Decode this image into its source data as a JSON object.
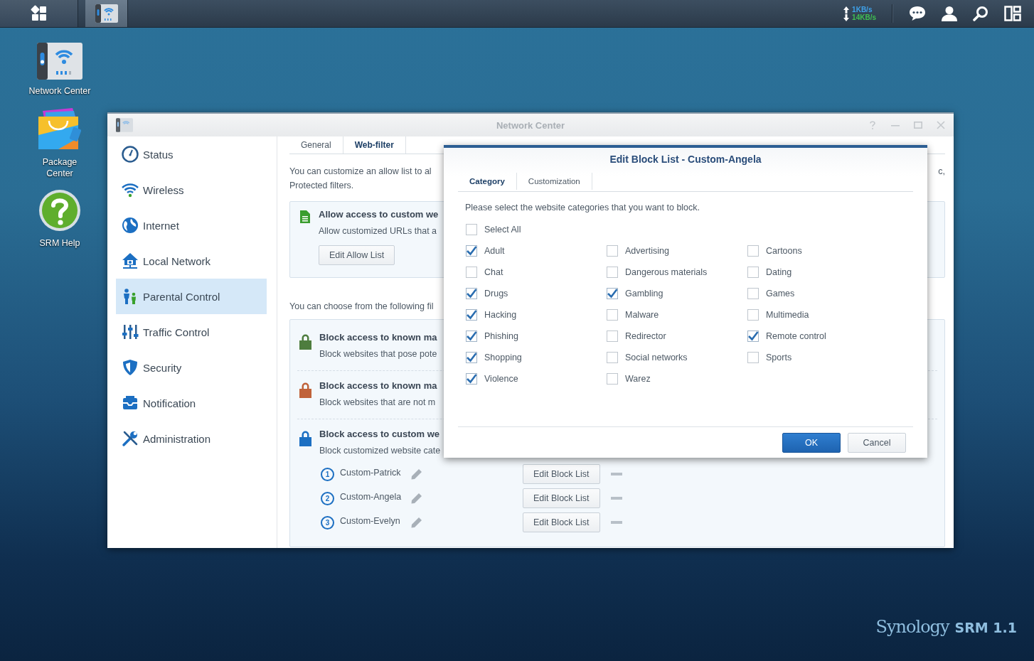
{
  "taskbar": {
    "upload": "1KB/s",
    "download": "14KB/s"
  },
  "desktop_icons": [
    {
      "label": "Network Center",
      "kind": "network"
    },
    {
      "label": "Package Center",
      "kind": "package"
    },
    {
      "label": "SRM Help",
      "kind": "help"
    }
  ],
  "window": {
    "title": "Network Center"
  },
  "sidebar": {
    "items": [
      {
        "label": "Status",
        "kind": "status",
        "selected": false
      },
      {
        "label": "Wireless",
        "kind": "wireless",
        "selected": false
      },
      {
        "label": "Internet",
        "kind": "internet",
        "selected": false
      },
      {
        "label": "Local Network",
        "kind": "local",
        "selected": false
      },
      {
        "label": "Parental Control",
        "kind": "parental",
        "selected": true
      },
      {
        "label": "Traffic Control",
        "kind": "traffic",
        "selected": false
      },
      {
        "label": "Security",
        "kind": "security",
        "selected": false
      },
      {
        "label": "Notification",
        "kind": "notification",
        "selected": false
      },
      {
        "label": "Administration",
        "kind": "administration",
        "selected": false
      }
    ]
  },
  "tabs": [
    {
      "label": "General",
      "selected": false
    },
    {
      "label": "Web-filter",
      "selected": true
    }
  ],
  "intro": {
    "lines": [
      "You can customize an allow list to al",
      "Protected filters."
    ],
    "tail": "c,"
  },
  "allow_section": {
    "title": "Allow access to custom we",
    "description": "Allow customized URLs that a",
    "button": "Edit Allow List"
  },
  "filters_intro": "You can choose from the following fil",
  "filters": [
    {
      "title": "Block access to known ma",
      "description": "Block websites that pose pote",
      "color": "#4e7d3e"
    },
    {
      "title": "Block access to known ma",
      "description": "Block websites that are not m",
      "color": "#c0623a"
    },
    {
      "title": "Block access to custom we",
      "description": "Block customized website cate",
      "color": "#1c6fc2",
      "profiles": [
        {
          "number": "1",
          "name": "Custom-Patrick",
          "button": "Edit Block List"
        },
        {
          "number": "2",
          "name": "Custom-Angela",
          "button": "Edit Block List"
        },
        {
          "number": "3",
          "name": "Custom-Evelyn",
          "button": "Edit Block List"
        }
      ]
    }
  ],
  "dialog": {
    "title": "Edit Block List - Custom-Angela",
    "tabs": [
      {
        "label": "Category",
        "selected": true
      },
      {
        "label": "Customization",
        "selected": false
      }
    ],
    "instruction": "Please select the website categories that you want to block.",
    "select_all": {
      "label": "Select All",
      "checked": false
    },
    "categories": [
      {
        "label": "Adult",
        "checked": true
      },
      {
        "label": "Advertising",
        "checked": false
      },
      {
        "label": "Cartoons",
        "checked": false
      },
      {
        "label": "Chat",
        "checked": false
      },
      {
        "label": "Dangerous materials",
        "checked": false
      },
      {
        "label": "Dating",
        "checked": false
      },
      {
        "label": "Drugs",
        "checked": true
      },
      {
        "label": "Gambling",
        "checked": true
      },
      {
        "label": "Games",
        "checked": false
      },
      {
        "label": "Hacking",
        "checked": true
      },
      {
        "label": "Malware",
        "checked": false
      },
      {
        "label": "Multimedia",
        "checked": false
      },
      {
        "label": "Phishing",
        "checked": true
      },
      {
        "label": "Redirector",
        "checked": false
      },
      {
        "label": "Remote control",
        "checked": true
      },
      {
        "label": "Shopping",
        "checked": true
      },
      {
        "label": "Social networks",
        "checked": false
      },
      {
        "label": "Sports",
        "checked": false
      },
      {
        "label": "Violence",
        "checked": true
      },
      {
        "label": "Warez",
        "checked": false
      }
    ],
    "buttons": [
      {
        "label": "OK",
        "kind": "primary"
      },
      {
        "label": "Cancel",
        "kind": "secondary"
      }
    ]
  },
  "brand": {
    "name": "Synology",
    "product": "SRM 1.1"
  }
}
